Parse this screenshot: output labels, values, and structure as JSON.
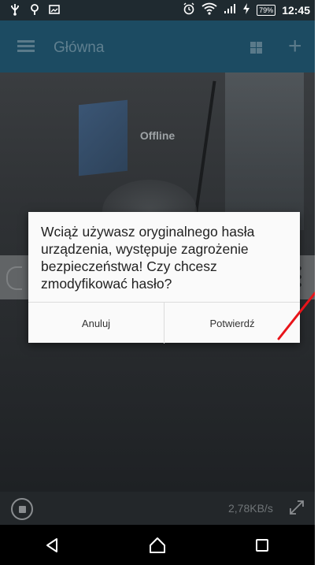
{
  "status_bar": {
    "time": "12:45",
    "battery": "79%"
  },
  "app_bar": {
    "title": "Główna"
  },
  "camera": {
    "status_label": "Offline",
    "speed": "2,78KB/s"
  },
  "dialog": {
    "message": "Wciąż używasz oryginalnego hasła urządzenia, występuje zagrożenie bezpieczeństwa! Czy chcesz zmodyfikować hasło?",
    "cancel_label": "Anuluj",
    "confirm_label": "Potwierdź"
  },
  "colors": {
    "app_bar": "#1c4b62",
    "status_bar": "#1f2a30",
    "annotation": "#e8141a"
  },
  "icons": {
    "status_left": [
      "usb-icon",
      "location-icon",
      "image-icon"
    ],
    "status_right": [
      "alarm-icon",
      "wifi-icon",
      "signal-icon",
      "charging-icon"
    ],
    "nav": [
      "back-icon",
      "home-icon",
      "recent-apps-icon"
    ]
  }
}
